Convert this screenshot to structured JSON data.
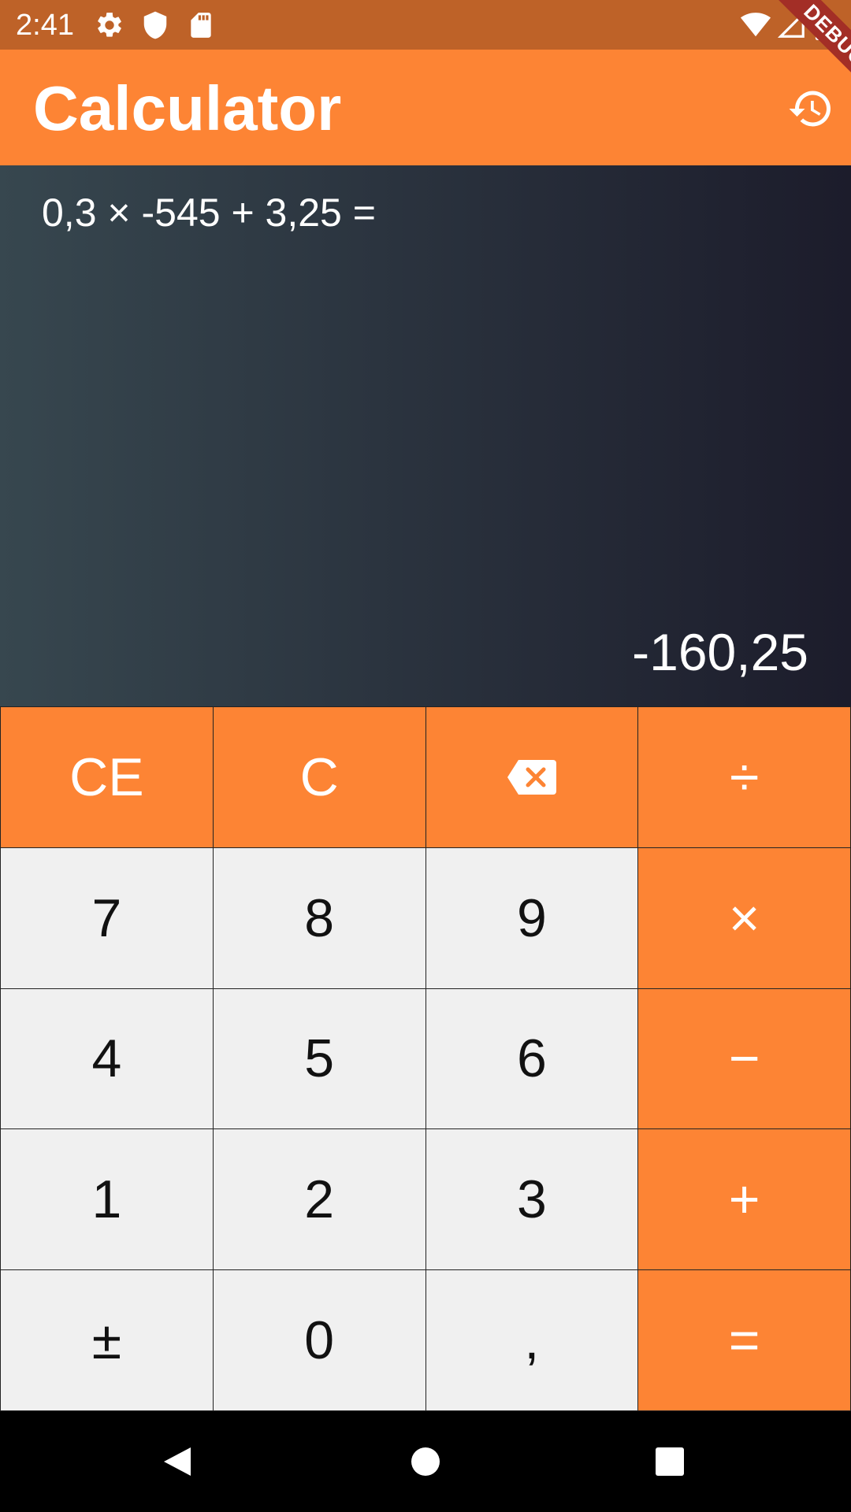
{
  "status_bar": {
    "time": "2:41",
    "left_icons": [
      "gear-icon",
      "shield-icon",
      "sd-card-icon"
    ],
    "right_icons": [
      "wifi-icon",
      "signal-icon",
      "battery-icon"
    ],
    "background_color": "#BE6228"
  },
  "debug_banner": {
    "label": "DEBUG"
  },
  "app_bar": {
    "title": "Calculator",
    "history_icon": "history-icon",
    "background_color": "#FD8434"
  },
  "display": {
    "expression": "0,3 × -545 + 3,25 =",
    "result": "-160,25"
  },
  "keypad": {
    "accent_color": "#FD8434",
    "number_key_color": "#F0F0F0",
    "rows": [
      [
        "CE",
        "C",
        "backspace-icon",
        "÷"
      ],
      [
        "7",
        "8",
        "9",
        "×"
      ],
      [
        "4",
        "5",
        "6",
        "−"
      ],
      [
        "1",
        "2",
        "3",
        "+"
      ],
      [
        "±",
        "0",
        ",",
        "="
      ]
    ],
    "keys": {
      "ce": "CE",
      "c": "C",
      "backspace": "backspace-icon",
      "divide": "÷",
      "seven": "7",
      "eight": "8",
      "nine": "9",
      "multiply": "×",
      "four": "4",
      "five": "5",
      "six": "6",
      "minus": "−",
      "one": "1",
      "two": "2",
      "three": "3",
      "plus": "+",
      "plus_minus": "±",
      "zero": "0",
      "comma": ",",
      "equals": "="
    }
  },
  "nav_bar": {
    "icons": [
      "back-icon",
      "home-icon",
      "recents-icon"
    ]
  }
}
